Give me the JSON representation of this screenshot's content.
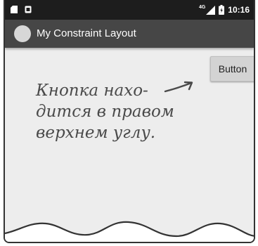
{
  "status_bar": {
    "network": "4G",
    "time": "10:16",
    "icons": [
      "sd-card-icon",
      "notification-icon",
      "signal-icon",
      "battery-icon"
    ]
  },
  "app_bar": {
    "title": "My Constraint Layout",
    "icon": "android-launcher-icon"
  },
  "content": {
    "button_label": "Button"
  },
  "annotation": {
    "lines": [
      "Кнопка нахо-",
      "дится в правом",
      "верхнем углу."
    ]
  },
  "colors": {
    "status_bar": "#1d1d1d",
    "app_bar": "#464646",
    "background": "#ededed",
    "button": "#d3d3d3",
    "annotation_text": "#4a4a4a"
  }
}
